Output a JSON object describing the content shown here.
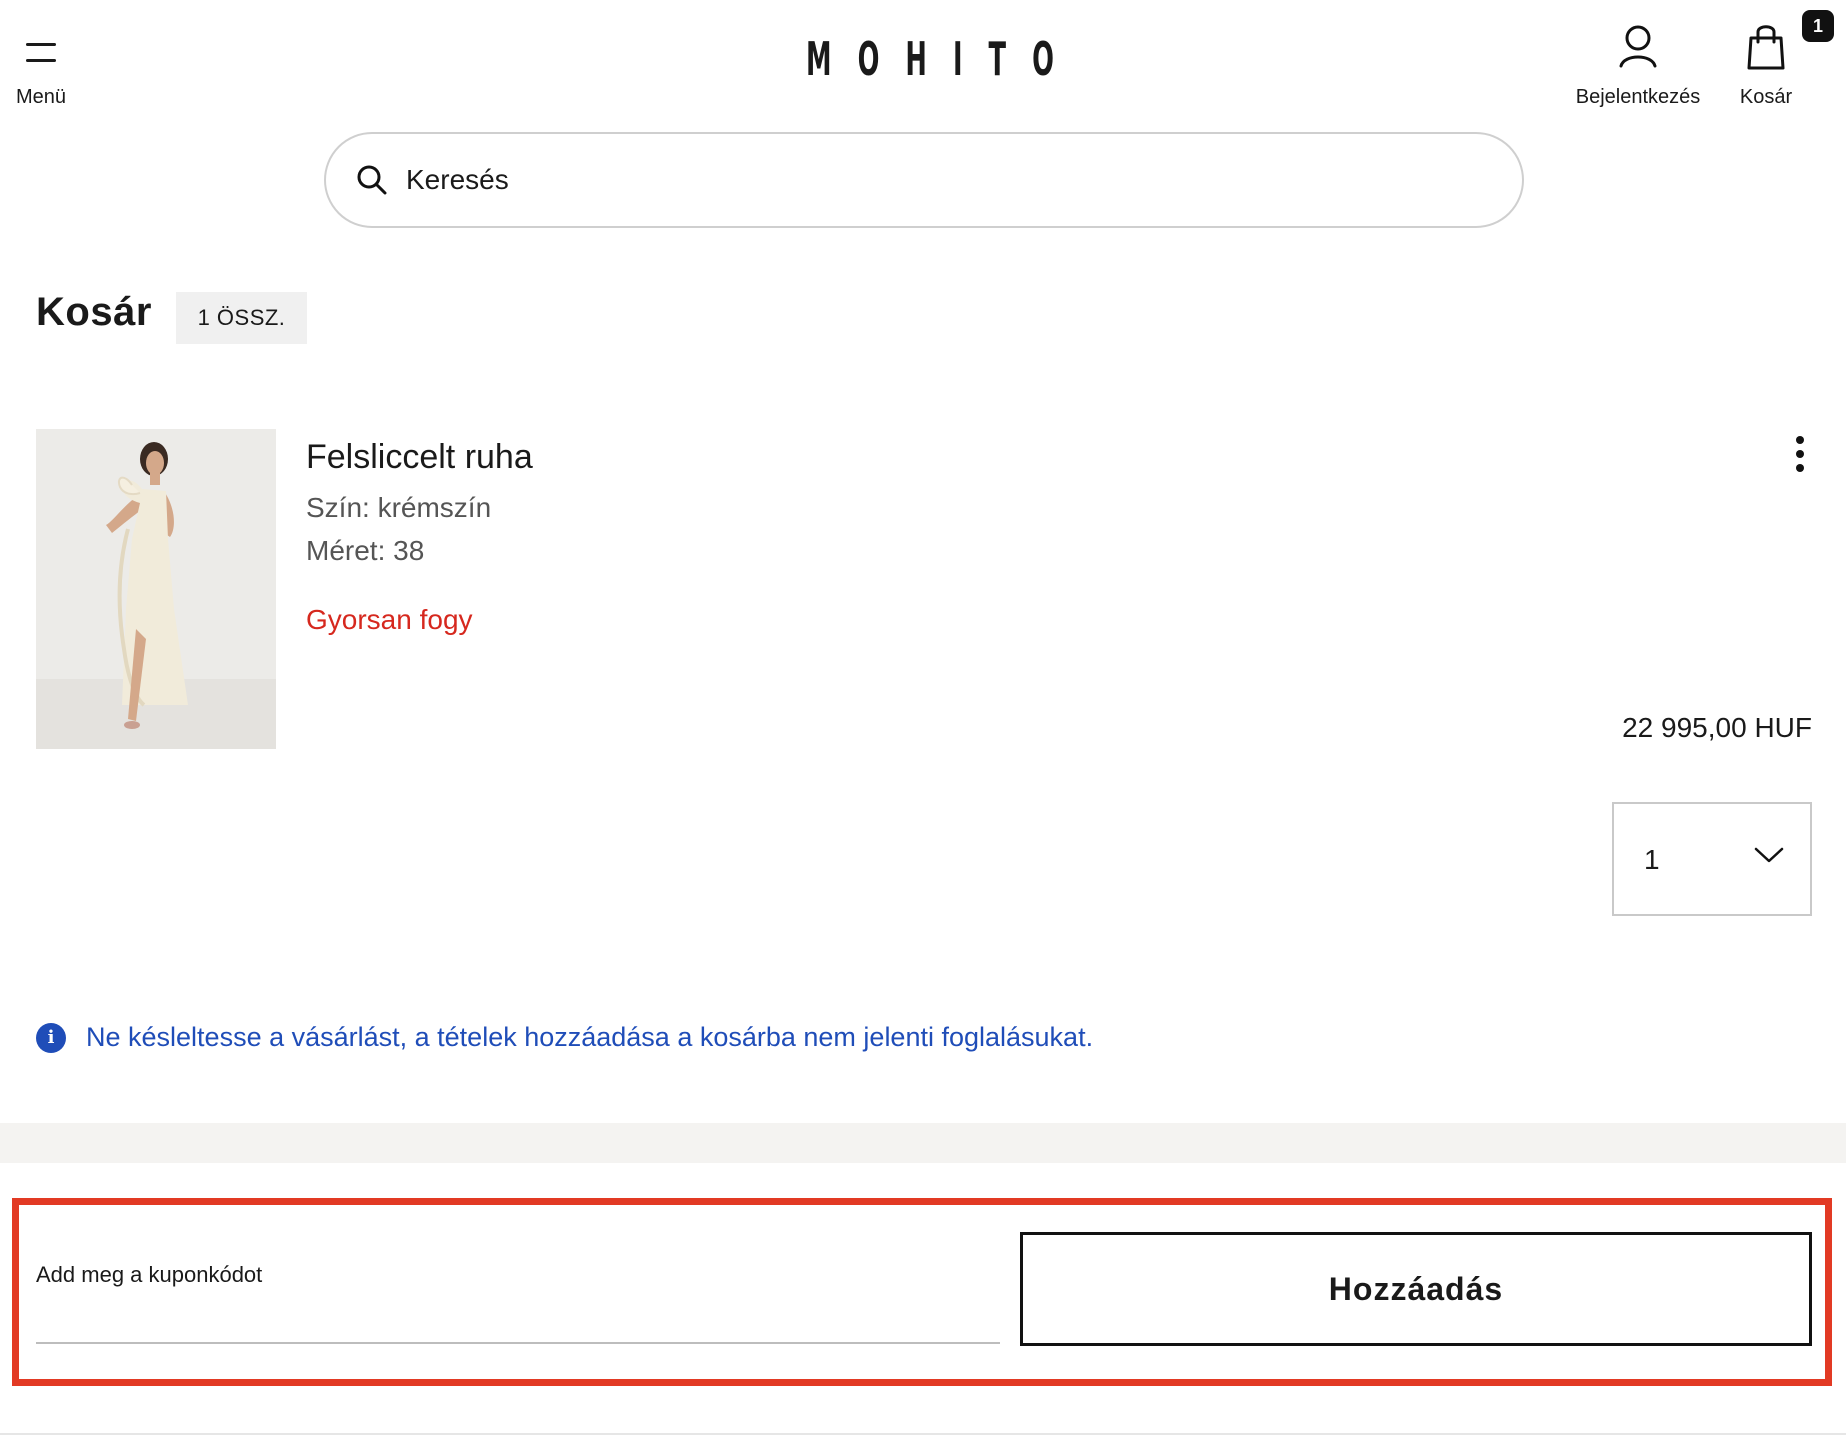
{
  "header": {
    "menu_label": "Menü",
    "logo": "MOHITO",
    "account_label": "Bejelentkezés",
    "cart_label": "Kosár",
    "cart_count": "1"
  },
  "search": {
    "placeholder": "Keresés"
  },
  "cart": {
    "title": "Kosár",
    "count_label": "1 ÖSSZ."
  },
  "product": {
    "name": "Felsliccelt ruha",
    "color": "Szín: krémszín",
    "size": "Méret: 38",
    "stock_status": "Gyorsan fogy",
    "price": "22 995,00 HUF",
    "quantity": "1"
  },
  "info": {
    "message": "Ne késleltesse a vásárlást, a tételek hozzáadása a kosárba nem jelenti foglalásukat."
  },
  "coupon": {
    "label": "Add meg a kuponkódot",
    "value": "",
    "button_label": "Hozzáadás"
  },
  "colors": {
    "accent_blue": "#1f4db8",
    "stock_red": "#d6281e",
    "highlight_red": "#e23a24"
  }
}
